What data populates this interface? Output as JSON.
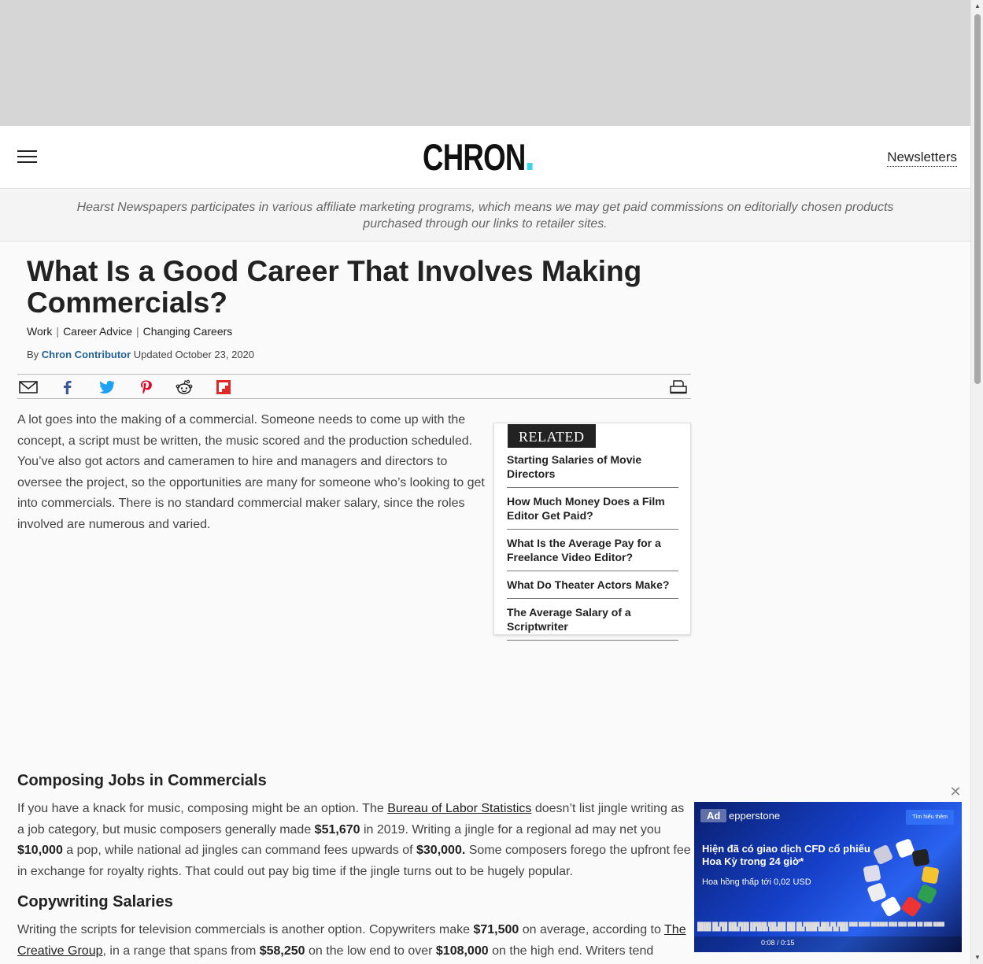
{
  "header": {
    "logo_text": "CHRON",
    "logo_dot_color": "#3ed5ec",
    "newsletters_label": "Newsletters",
    "menu_icon": "hamburger-menu-icon"
  },
  "disclaimer": "Hearst Newspapers participates in various affiliate marketing programs, which means we may get paid commissions on editorially chosen products purchased through our links to retailer sites.",
  "article": {
    "title": "What Is a Good Career That Involves Making Commercials?",
    "breadcrumbs": [
      "Work",
      "Career Advice",
      "Changing Careers"
    ],
    "byline_prefix": "By",
    "author": "Chron Contributor",
    "updated": "Updated October 23, 2020",
    "intro": "A lot goes into the making of a commercial. Someone needs to come up with the concept, a script must be written, the music scored and the production scheduled. You’ve also got actors and cameramen to hire and managers and directors to oversee the project, so the opportunities are many for someone who’s looking to get into commercials. There is no standard commercial maker salary, since the roles involved are numerous and varied.",
    "section1_heading": "Composing Jobs in Commercials",
    "section1": {
      "t1": "If you have a knack for music, composing might be an option. The ",
      "link": "Bureau of Labor Statistics",
      "t2": " doesn’t list jingle writing as a job category, but music composers generally made ",
      "b1": "$51,670",
      "t3": " in 2019. Writing a jingle for a regional ad may net you ",
      "b2": "$10,000",
      "t4": " a pop, while national ad jingles can command fees upwards of ",
      "b3": "$30,000.",
      "t5": " Some composers forego the upfront fee in exchange for royalty rights. That could out pay big time if the jingle turns out to be hugely popular."
    },
    "section2_heading": "Copywriting Salaries",
    "section2": {
      "t1": "Writing the scripts for television commercials is another option. Copywriters make ",
      "b1": "$71,500",
      "t2": " on average, according to ",
      "link": "The Creative Group",
      "t3": ", in a range that spans from ",
      "b2": "$58,250",
      "t4": " on the low end to over ",
      "b3": "$108,000",
      "t5": " on the high end. Writers tend"
    }
  },
  "share_icons": [
    "email-icon",
    "facebook-icon",
    "twitter-icon",
    "pinterest-icon",
    "reddit-icon",
    "flipboard-icon",
    "print-icon"
  ],
  "related": {
    "tag": "RELATED",
    "items": [
      "Starting Salaries of Movie Directors",
      "How Much Money Does a Film Editor Get Paid?",
      "What Is the Average Pay for a Freelance Video Editor?",
      "What Do Theater Actors Make?",
      "The Average Salary of a Scriptwriter"
    ]
  },
  "video_ad": {
    "badge": "Ad",
    "brand": "epperstone",
    "cta": "Tìm hiểu thêm",
    "headline": "Hiện đã có giao dịch CFD cổ phiếu Hoa Kỳ trong 24 giờ*",
    "sub": "Hoa hồng thấp tới 0,02 USD",
    "time": "0:08 / 0:15",
    "close_icon": "close-icon"
  },
  "colors": {
    "author_link": "#246296",
    "ad_top_bg": "#d6d6d6",
    "related_tag_bg": "#222222"
  }
}
